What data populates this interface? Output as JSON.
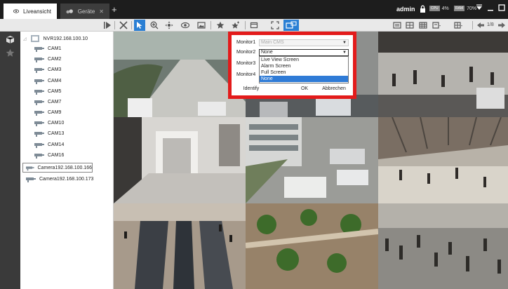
{
  "tabs": [
    {
      "label": "Liveansicht",
      "active": true
    },
    {
      "label": "Geräte",
      "active": false
    }
  ],
  "status": {
    "user": "admin",
    "cpu_label": "CPU",
    "cpu_value": "4%",
    "ram_label": "RAM",
    "ram_value": "70%"
  },
  "toolbar": {
    "page": "1/8"
  },
  "tree": {
    "nvr": "NVR192.168.100.10",
    "cams": [
      "CAM1",
      "CAM2",
      "CAM3",
      "CAM4",
      "CAM5",
      "CAM7",
      "CAM9",
      "CAM10",
      "CAM13",
      "CAM14",
      "CAM16"
    ],
    "cameras": [
      "Camera192.168.100.166",
      "Camera192.168.100.173"
    ]
  },
  "dialog": {
    "monitor1_label": "Monitor1",
    "monitor1_value": "Main CMS",
    "monitor2_label": "Monitor2",
    "monitor2_value": "None",
    "monitor3_label": "Monitor3",
    "monitor4_label": "Monitor4",
    "options": [
      "Live View Screen",
      "Alarm Screen",
      "Full Screen",
      "None"
    ],
    "highlighted_option": "None",
    "identify": "Identify",
    "ok": "OK",
    "cancel": "Abbrechen"
  },
  "colors": {
    "titlebar": "#1d1d1d",
    "accent": "#2a7fd4",
    "dialog_frame": "#e31b1b"
  }
}
